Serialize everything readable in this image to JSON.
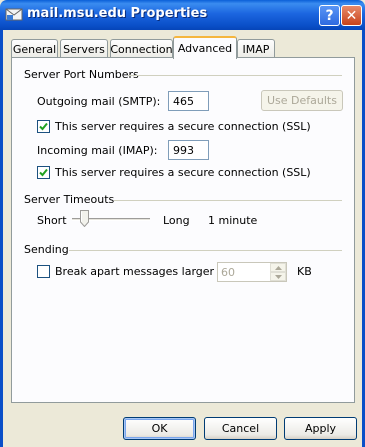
{
  "window": {
    "title": "mail.msu.edu Properties",
    "help_glyph": "?",
    "close_glyph": "✕",
    "icons": {
      "app": "envelope-icon",
      "help": "help-icon",
      "close": "close-icon"
    }
  },
  "tabs": [
    {
      "label": "General",
      "active": false
    },
    {
      "label": "Servers",
      "active": false
    },
    {
      "label": "Connection",
      "active": false
    },
    {
      "label": "Advanced",
      "active": true
    },
    {
      "label": "IMAP",
      "active": false
    }
  ],
  "server_ports": {
    "heading": "Server Port Numbers",
    "outgoing_label": "Outgoing mail (SMTP):",
    "outgoing_value": "465",
    "use_defaults_label": "Use Defaults",
    "outgoing_ssl_label": "This server requires a secure connection (SSL)",
    "outgoing_ssl_checked": true,
    "incoming_label": "Incoming mail (IMAP):",
    "incoming_value": "993",
    "incoming_ssl_label": "This server requires a secure connection (SSL)",
    "incoming_ssl_checked": true
  },
  "timeouts": {
    "heading": "Server Timeouts",
    "short_label": "Short",
    "long_label": "Long",
    "value_text": "1 minute",
    "slider_level": 0.12
  },
  "sending": {
    "heading": "Sending",
    "break_apart_label": "Break apart messages larger than",
    "break_apart_checked": false,
    "size_value": "60",
    "size_unit": "KB"
  },
  "buttons": {
    "ok": "OK",
    "cancel": "Cancel",
    "apply": "Apply"
  },
  "colors": {
    "titlebar": "#0a4fc8",
    "dialog_bg": "#ece9d8",
    "panel_bg": "#fcfcfe",
    "active_tab_accent": "#f5b63e",
    "close_button": "#c8421a",
    "checkmark": "#21a121"
  }
}
